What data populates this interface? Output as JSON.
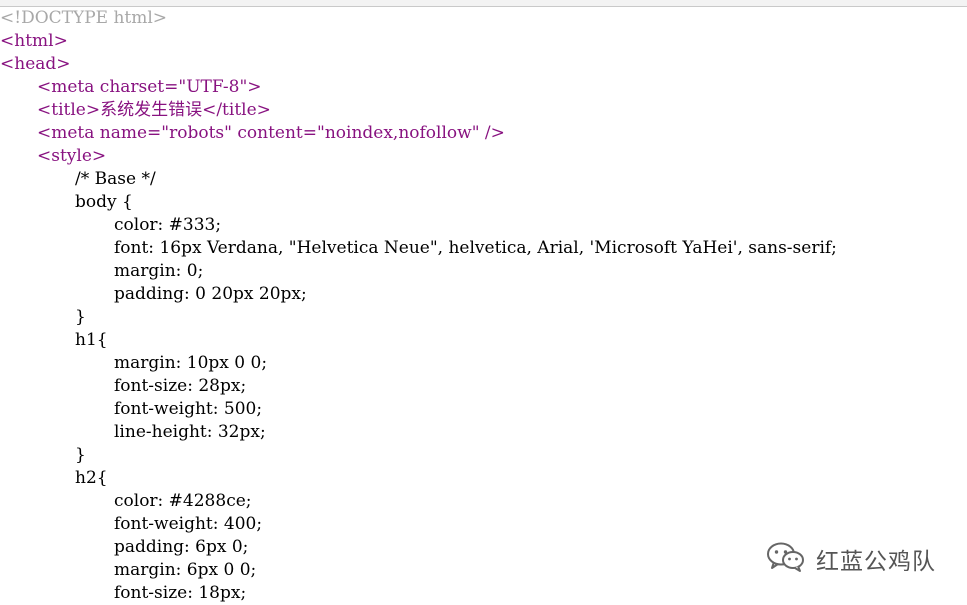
{
  "view": {
    "lines": [
      "<!DOCTYPE html>",
      "<html>",
      "<head>",
      "<meta charset=\"UTF-8\">",
      "<title>系统发生错误</title>",
      "<meta name=\"robots\" content=\"noindex,nofollow\" />",
      "<style>",
      "/* Base */",
      "body {",
      "color: #333;",
      "font: 16px Verdana, \"Helvetica Neue\", helvetica, Arial, 'Microsoft YaHei', sans-serif;",
      "margin: 0;",
      "padding: 0 20px 20px;",
      "}",
      "h1{",
      "margin: 10px 0 0;",
      "font-size: 28px;",
      "font-weight: 500;",
      "line-height: 32px;",
      "}",
      "h2{",
      "color: #4288ce;",
      "font-weight: 400;",
      "padding: 6px 0;",
      "margin: 6px 0 0;",
      "font-size: 18px;"
    ]
  },
  "watermark": {
    "icon": "wechat-icon",
    "text": "红蓝公鸡队"
  },
  "colors": {
    "doctype": "#a8a8a8",
    "tag": "#881280",
    "attribute": "#994500",
    "value": "#1a1aa6",
    "text": "#000000"
  }
}
